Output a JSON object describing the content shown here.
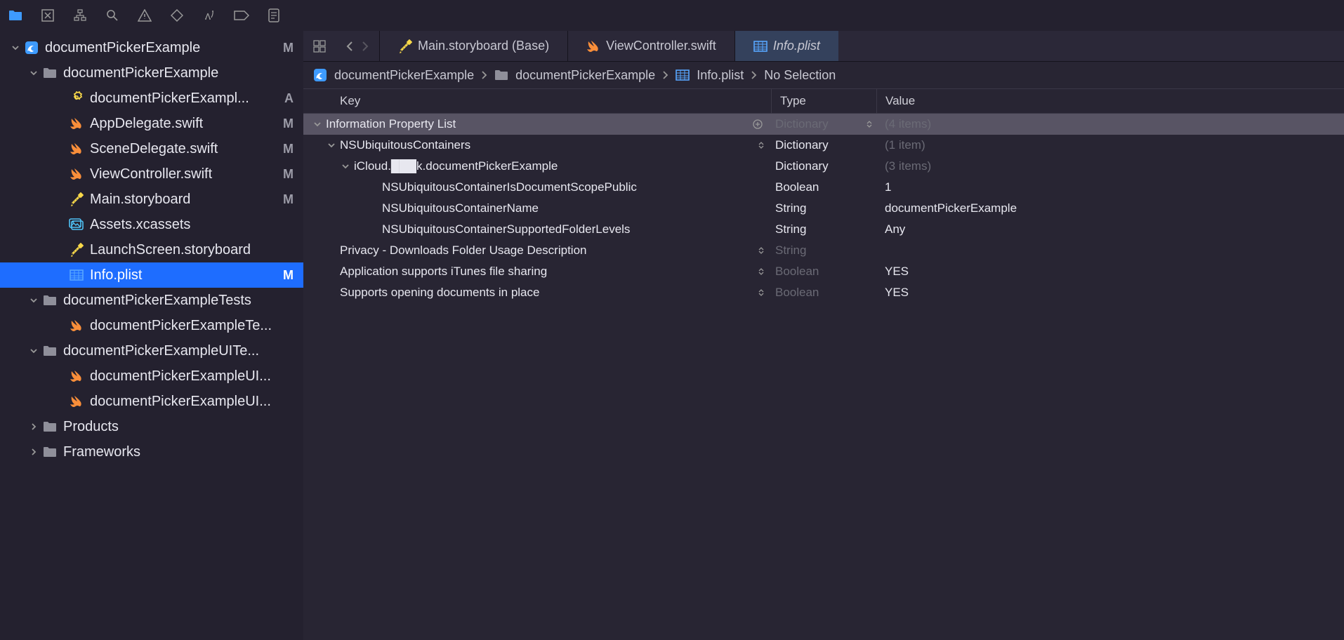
{
  "toolbar_icons": [
    "folder",
    "box-x",
    "hierarchy",
    "search",
    "warning",
    "diamond",
    "spray",
    "pill",
    "doc"
  ],
  "tree": [
    {
      "d": 0,
      "icon": "app",
      "label": "documentPickerExample",
      "badge": "M",
      "disc": "down"
    },
    {
      "d": 1,
      "icon": "folder",
      "label": "documentPickerExample",
      "badge": "",
      "disc": "down"
    },
    {
      "d": 2,
      "icon": "gear-badge",
      "label": "documentPickerExampl...",
      "badge": "A",
      "disc": null
    },
    {
      "d": 2,
      "icon": "swift",
      "label": "AppDelegate.swift",
      "badge": "M",
      "disc": null
    },
    {
      "d": 2,
      "icon": "swift",
      "label": "SceneDelegate.swift",
      "badge": "M",
      "disc": null
    },
    {
      "d": 2,
      "icon": "swift",
      "label": "ViewController.swift",
      "badge": "M",
      "disc": null
    },
    {
      "d": 2,
      "icon": "storyboard",
      "label": "Main.storyboard",
      "badge": "M",
      "disc": null
    },
    {
      "d": 2,
      "icon": "assets",
      "label": "Assets.xcassets",
      "badge": "",
      "disc": null
    },
    {
      "d": 2,
      "icon": "storyboard",
      "label": "LaunchScreen.storyboard",
      "badge": "",
      "disc": null
    },
    {
      "d": 2,
      "icon": "plist",
      "label": "Info.plist",
      "badge": "M",
      "disc": null,
      "selected": true
    },
    {
      "d": 1,
      "icon": "folder",
      "label": "documentPickerExampleTests",
      "badge": "",
      "disc": "down"
    },
    {
      "d": 2,
      "icon": "swift",
      "label": "documentPickerExampleTe...",
      "badge": "",
      "disc": null
    },
    {
      "d": 1,
      "icon": "folder",
      "label": "documentPickerExampleUITe...",
      "badge": "",
      "disc": "down"
    },
    {
      "d": 2,
      "icon": "swift",
      "label": "documentPickerExampleUI...",
      "badge": "",
      "disc": null
    },
    {
      "d": 2,
      "icon": "swift",
      "label": "documentPickerExampleUI...",
      "badge": "",
      "disc": null
    },
    {
      "d": 1,
      "icon": "folder",
      "label": "Products",
      "badge": "",
      "disc": "right"
    },
    {
      "d": 1,
      "icon": "folder",
      "label": "Frameworks",
      "badge": "",
      "disc": "right"
    }
  ],
  "tabs": [
    {
      "icon": "storyboard",
      "label": "Main.storyboard (Base)"
    },
    {
      "icon": "swift",
      "label": "ViewController.swift"
    },
    {
      "icon": "plist",
      "label": "Info.plist",
      "active": true,
      "italic": true
    }
  ],
  "breadcrumb": [
    {
      "icon": "app",
      "label": "documentPickerExample"
    },
    {
      "icon": "folder",
      "label": "documentPickerExample"
    },
    {
      "icon": "plist",
      "label": "Info.plist"
    },
    {
      "icon": null,
      "label": "No Selection"
    }
  ],
  "plist_header": {
    "key": "Key",
    "type": "Type",
    "value": "Value"
  },
  "plist_rows": [
    {
      "indent": 0,
      "disc": "down",
      "key": "Information Property List",
      "plus": true,
      "updown": false,
      "type": "Dictionary",
      "typeDim": true,
      "typeUD": true,
      "value": "(4 items)",
      "valueDim": true,
      "highlight": true
    },
    {
      "indent": 1,
      "disc": "down",
      "key": "NSUbiquitousContainers",
      "updown": true,
      "type": "Dictionary",
      "value": "(1 item)",
      "valueDim": true
    },
    {
      "indent": 2,
      "disc": "down",
      "key": "iCloud.███k.documentPickerExample",
      "type": "Dictionary",
      "value": "(3 items)",
      "valueDim": true
    },
    {
      "indent": 3,
      "disc": null,
      "key": "NSUbiquitousContainerIsDocumentScopePublic",
      "type": "Boolean",
      "value": "1"
    },
    {
      "indent": 3,
      "disc": null,
      "key": "NSUbiquitousContainerName",
      "type": "String",
      "value": "documentPickerExample"
    },
    {
      "indent": 3,
      "disc": null,
      "key": "NSUbiquitousContainerSupportedFolderLevels",
      "type": "String",
      "value": "Any"
    },
    {
      "indent": 1,
      "disc": null,
      "key": "Privacy - Downloads Folder Usage Description",
      "updown": true,
      "type": "String",
      "typeDim": true,
      "value": ""
    },
    {
      "indent": 1,
      "disc": null,
      "key": "Application supports iTunes file sharing",
      "updown": true,
      "type": "Boolean",
      "typeDim": true,
      "value": "YES"
    },
    {
      "indent": 1,
      "disc": null,
      "key": "Supports opening documents in place",
      "updown": true,
      "type": "Boolean",
      "typeDim": true,
      "value": "YES"
    }
  ]
}
